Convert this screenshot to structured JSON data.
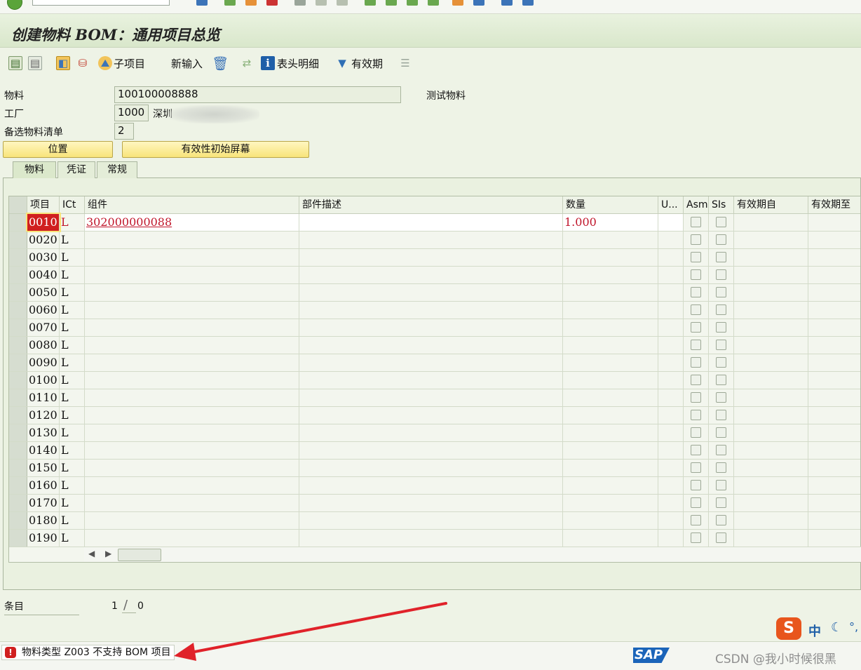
{
  "title": "创建物料 BOM：通用项目总览",
  "toolbar": {
    "subitem_label": "子项目",
    "new_entry_label": "新输入",
    "header_detail_label": "表头明细",
    "validity_label": "有效期"
  },
  "header": {
    "material_label": "物料",
    "material_value": "100100008888",
    "material_desc": "测试物料",
    "plant_label": "工厂",
    "plant_value": "1000",
    "plant_desc": "深圳",
    "alt_bom_label": "备选物料清单",
    "alt_bom_value": "2",
    "position_button": "位置",
    "validity_initial_button": "有效性初始屏幕"
  },
  "tabs": [
    {
      "label": "物料",
      "active": true
    },
    {
      "label": "凭证",
      "active": false
    },
    {
      "label": "常规",
      "active": false
    }
  ],
  "table": {
    "columns": [
      "项目",
      "ICt",
      "组件",
      "部件描述",
      "数量",
      "U...",
      "Asm",
      "SIs",
      "有效期自",
      "有效期至"
    ],
    "rows": [
      {
        "item": "0010",
        "ict": "L",
        "component": "302000000088",
        "desc": "",
        "qty": "1.000",
        "unit": ""
      },
      {
        "item": "0020",
        "ict": "L",
        "component": "",
        "desc": "",
        "qty": "",
        "unit": ""
      },
      {
        "item": "0030",
        "ict": "L",
        "component": "",
        "desc": "",
        "qty": "",
        "unit": ""
      },
      {
        "item": "0040",
        "ict": "L",
        "component": "",
        "desc": "",
        "qty": "",
        "unit": ""
      },
      {
        "item": "0050",
        "ict": "L",
        "component": "",
        "desc": "",
        "qty": "",
        "unit": ""
      },
      {
        "item": "0060",
        "ict": "L",
        "component": "",
        "desc": "",
        "qty": "",
        "unit": ""
      },
      {
        "item": "0070",
        "ict": "L",
        "component": "",
        "desc": "",
        "qty": "",
        "unit": ""
      },
      {
        "item": "0080",
        "ict": "L",
        "component": "",
        "desc": "",
        "qty": "",
        "unit": ""
      },
      {
        "item": "0090",
        "ict": "L",
        "component": "",
        "desc": "",
        "qty": "",
        "unit": ""
      },
      {
        "item": "0100",
        "ict": "L",
        "component": "",
        "desc": "",
        "qty": "",
        "unit": ""
      },
      {
        "item": "0110",
        "ict": "L",
        "component": "",
        "desc": "",
        "qty": "",
        "unit": ""
      },
      {
        "item": "0120",
        "ict": "L",
        "component": "",
        "desc": "",
        "qty": "",
        "unit": ""
      },
      {
        "item": "0130",
        "ict": "L",
        "component": "",
        "desc": "",
        "qty": "",
        "unit": ""
      },
      {
        "item": "0140",
        "ict": "L",
        "component": "",
        "desc": "",
        "qty": "",
        "unit": ""
      },
      {
        "item": "0150",
        "ict": "L",
        "component": "",
        "desc": "",
        "qty": "",
        "unit": ""
      },
      {
        "item": "0160",
        "ict": "L",
        "component": "",
        "desc": "",
        "qty": "",
        "unit": ""
      },
      {
        "item": "0170",
        "ict": "L",
        "component": "",
        "desc": "",
        "qty": "",
        "unit": ""
      },
      {
        "item": "0180",
        "ict": "L",
        "component": "",
        "desc": "",
        "qty": "",
        "unit": ""
      },
      {
        "item": "0190",
        "ict": "L",
        "component": "",
        "desc": "",
        "qty": "",
        "unit": ""
      }
    ]
  },
  "entries": {
    "label": "条目",
    "current": "1",
    "separator": "/",
    "total": "0"
  },
  "status": {
    "message": "物料类型 Z003 不支持 BOM 项目",
    "error_icon": "!",
    "logo_text": "SAP"
  },
  "ime": {
    "logo": "S",
    "mode": "中"
  },
  "watermark": "CSDN @我小时候很黑",
  "colors": {
    "error": "#d01f1f",
    "link_red": "#c0162b",
    "arrow": "#e0222a",
    "highlight_yellow": "#f8e47a"
  }
}
